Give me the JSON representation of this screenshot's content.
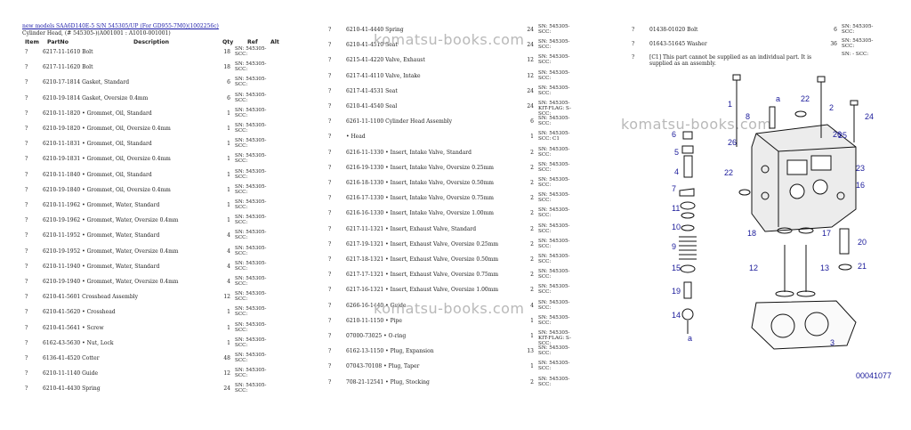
{
  "header": {
    "link": "new models SAA6D140E-5 S/N 545305/UP (For GD955-7M0)(1002256c)",
    "subtitle": "Cylinder Head, (# 545305-)(A001001 : A1010-001001)"
  },
  "columns": {
    "item": "Item",
    "partno": "PartNo",
    "description": "Description",
    "qty": "Qty",
    "ref": "Ref",
    "alt": "Alt"
  },
  "left_rows": [
    {
      "item": "?",
      "part": "6217-11-1610 Bolt",
      "qty": "18",
      "sn": "SN: 545305-SCC:"
    },
    {
      "item": "?",
      "part": "6217-11-1620 Bolt",
      "qty": "18",
      "sn": "SN: 545305-SCC:"
    },
    {
      "item": "?",
      "part": "6210-17-1814 Gasket, Standard",
      "qty": "6",
      "sn": "SN: 545305-SCC:"
    },
    {
      "item": "?",
      "part": "6210-19-1814 Gasket, Oversize 0.4mm",
      "qty": "6",
      "sn": "SN: 545305-SCC:"
    },
    {
      "item": "?",
      "part": "6210-11-1820 • Grommet, Oil, Standard",
      "qty": "1",
      "sn": "SN: 545305-SCC:"
    },
    {
      "item": "?",
      "part": "6210-19-1820 • Grommet, Oil, Oversize 0.4mm",
      "qty": "1",
      "sn": "SN: 545305-SCC:"
    },
    {
      "item": "?",
      "part": "6210-11-1831 • Grommet, Oil, Standard",
      "qty": "1",
      "sn": "SN: 545305-SCC:"
    },
    {
      "item": "?",
      "part": "6210-19-1831 • Grommet, Oil, Oversize 0.4mm",
      "qty": "1",
      "sn": "SN: 545305-SCC:"
    },
    {
      "item": "?",
      "part": "6210-11-1840 • Grommet, Oil, Standard",
      "qty": "1",
      "sn": "SN: 545305-SCC:"
    },
    {
      "item": "?",
      "part": "6210-19-1840 • Grommet, Oil, Oversize 0.4mm",
      "qty": "1",
      "sn": "SN: 545305-SCC:"
    },
    {
      "item": "?",
      "part": "6210-11-1962 • Grommet, Water, Standard",
      "qty": "1",
      "sn": "SN: 545305-SCC:"
    },
    {
      "item": "?",
      "part": "6210-19-1962 • Grommet, Water, Oversize 0.4mm",
      "qty": "1",
      "sn": "SN: 545305-SCC:"
    },
    {
      "item": "?",
      "part": "6210-11-1952 • Grommet, Water, Standard",
      "qty": "4",
      "sn": "SN: 545305-SCC:"
    },
    {
      "item": "?",
      "part": "6210-19-1952 • Grommet, Water, Oversize 0.4mm",
      "qty": "4",
      "sn": "SN: 545305-SCC:"
    },
    {
      "item": "?",
      "part": "6210-11-1940 • Grommet, Water, Standard",
      "qty": "4",
      "sn": "SN: 545305-SCC:"
    },
    {
      "item": "?",
      "part": "6210-19-1940 • Grommet, Water, Oversize 0.4mm",
      "qty": "4",
      "sn": "SN: 545305-SCC:"
    },
    {
      "item": "?",
      "part": "6210-41-5601 Crosshead Assembly",
      "qty": "12",
      "sn": "SN: 545305-SCC:"
    },
    {
      "item": "?",
      "part": "6210-41-5620 • Crosshead",
      "qty": "1",
      "sn": "SN: 545305-SCC:"
    },
    {
      "item": "?",
      "part": "6210-41-5641 • Screw",
      "qty": "1",
      "sn": "SN: 545305-SCC:"
    },
    {
      "item": "?",
      "part": "6162-43-5630 • Nut, Lock",
      "qty": "1",
      "sn": "SN: 545305-SCC:"
    },
    {
      "item": "?",
      "part": "6136-41-4520 Cotter",
      "qty": "48",
      "sn": "SN: 545305-SCC:"
    },
    {
      "item": "?",
      "part": "6210-11-1140 Guide",
      "qty": "12",
      "sn": "SN: 545305-SCC:"
    },
    {
      "item": "?",
      "part": "6210-41-4430 Spring",
      "qty": "24",
      "sn": "SN: 545305-SCC:"
    }
  ],
  "mid_rows": [
    {
      "item": "?",
      "part": "6210-41-4440 Spring",
      "qty": "24",
      "sn": "SN: 545305-SCC:"
    },
    {
      "item": "?",
      "part": "6210-41-4510 Seat",
      "qty": "24",
      "sn": "SN: 545305-SCC:"
    },
    {
      "item": "?",
      "part": "6215-41-4220 Valve, Exhaust",
      "qty": "12",
      "sn": "SN: 545305-SCC:"
    },
    {
      "item": "?",
      "part": "6217-41-4110 Valve, Intake",
      "qty": "12",
      "sn": "SN: 545305-SCC:"
    },
    {
      "item": "?",
      "part": "6217-41-4531 Seat",
      "qty": "24",
      "sn": "SN: 545305-SCC:"
    },
    {
      "item": "?",
      "part": "6210-41-4540 Seal",
      "qty": "24",
      "sn": "SN: 545305-KIT-FLAG: S-SCC:"
    },
    {
      "item": "?",
      "part": "6261-11-1100 Cylinder Head Assembly",
      "qty": "6",
      "sn": "SN: 545305-SCC:"
    },
    {
      "item": "?",
      "part": "• Head",
      "qty": "1",
      "sn": "SN: 545305-SCC: C1"
    },
    {
      "item": "?",
      "part": "6216-11-1330 • Insert, Intake Valve, Standard",
      "qty": "2",
      "sn": "SN: 545305-SCC:"
    },
    {
      "item": "?",
      "part": "6216-19-1330 • Insert, Intake Valve, Oversize 0.25mm",
      "qty": "2",
      "sn": "SN: 545305-SCC:"
    },
    {
      "item": "?",
      "part": "6216-18-1330 • Insert, Intake Valve, Oversize 0.50mm",
      "qty": "2",
      "sn": "SN: 545305-SCC:"
    },
    {
      "item": "?",
      "part": "6216-17-1330 • Insert, Intake Valve, Oversize 0.75mm",
      "qty": "2",
      "sn": "SN: 545305-SCC:"
    },
    {
      "item": "?",
      "part": "6216-16-1330 • Insert, Intake Valve, Oversize 1.00mm",
      "qty": "2",
      "sn": "SN: 545305-SCC:"
    },
    {
      "item": "?",
      "part": "6217-11-1321 • Insert, Exhaust Valve, Standard",
      "qty": "2",
      "sn": "SN: 545305-SCC:"
    },
    {
      "item": "?",
      "part": "6217-19-1321 • Insert, Exhaust Valve, Oversize 0.25mm",
      "qty": "2",
      "sn": "SN: 545305-SCC:"
    },
    {
      "item": "?",
      "part": "6217-18-1321 • Insert, Exhaust Valve, Oversize 0.50mm",
      "qty": "2",
      "sn": "SN: 545305-SCC:"
    },
    {
      "item": "?",
      "part": "6217-17-1321 • Insert, Exhaust Valve, Oversize 0.75mm",
      "qty": "2",
      "sn": "SN: 545305-SCC:"
    },
    {
      "item": "?",
      "part": "6217-16-1321 • Insert, Exhaust Valve, Oversize 1.00mm",
      "qty": "2",
      "sn": "SN: 545305-SCC:"
    },
    {
      "item": "?",
      "part": "6266-16-1440 • Guide",
      "qty": "4",
      "sn": "SN: 545305-SCC:"
    },
    {
      "item": "?",
      "part": "6210-11-1150 • Pipe",
      "qty": "1",
      "sn": "SN: 545305-SCC:"
    },
    {
      "item": "?",
      "part": "07000-73025 • O-ring",
      "qty": "1",
      "sn": "SN: 545305-KIT-FLAG: S-SCC:"
    },
    {
      "item": "?",
      "part": "6162-13-1150 • Plug, Expansion",
      "qty": "13",
      "sn": "SN: 545305-SCC:"
    },
    {
      "item": "?",
      "part": "07043-70108 • Plug, Taper",
      "qty": "1",
      "sn": "SN: 545305-SCC:"
    },
    {
      "item": "?",
      "part": "708-21-12541 • Plug, Stocking",
      "qty": "2",
      "sn": "SN: 545305-SCC:"
    }
  ],
  "right_rows": [
    {
      "item": "?",
      "part": "01438-01020 Bolt",
      "qty": "6",
      "sn": "SN: 545305-SCC:"
    },
    {
      "item": "?",
      "part": "01643-51645 Washer",
      "qty": "36",
      "sn": "SN: 545305-SCC:"
    },
    {
      "item": "?",
      "part": "[C1] This part cannot be supplied as an individual part. It is supplied as an assembly.",
      "qty": "",
      "sn": "SN: - SCC:"
    }
  ],
  "watermark": "komatsu-books.com",
  "figure_number": "00041077",
  "callouts": [
    "1",
    "2",
    "3",
    "4",
    "5",
    "6",
    "7",
    "8",
    "9",
    "10",
    "11",
    "12",
    "13",
    "14",
    "15",
    "16",
    "17",
    "18",
    "19",
    "20",
    "21",
    "22",
    "22",
    "23",
    "24",
    "25",
    "26",
    "26",
    "a",
    "a"
  ],
  "colors": {
    "link": "#1a1aa8",
    "callout": "#1a1a9a",
    "watermark": "#b9b9b9"
  }
}
